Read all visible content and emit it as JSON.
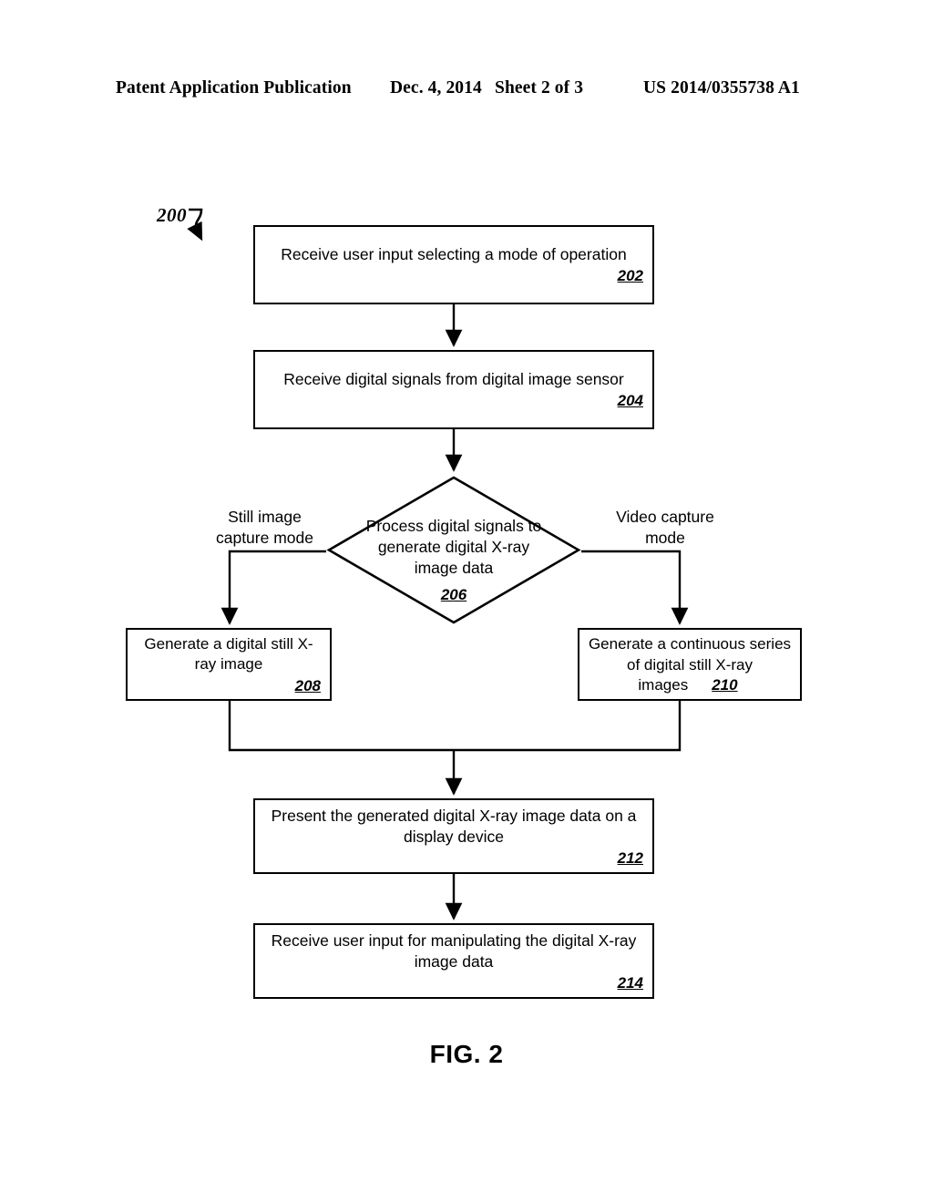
{
  "header": {
    "publication": "Patent Application Publication",
    "date": "Dec. 4, 2014",
    "sheet": "Sheet 2 of 3",
    "patent_number": "US 2014/0355738 A1"
  },
  "figure": {
    "caption": "FIG. 2",
    "reference_numeral": "200"
  },
  "flowchart": {
    "nodes": [
      {
        "id": "202",
        "type": "process",
        "text": "Receive user input selecting a mode of operation",
        "number": "202"
      },
      {
        "id": "204",
        "type": "process",
        "text": "Receive digital signals from digital image sensor",
        "number": "204"
      },
      {
        "id": "206",
        "type": "decision",
        "text": "Process digital signals to generate digital X-ray image data",
        "number": "206"
      },
      {
        "id": "208",
        "type": "process",
        "text": "Generate a digital still X-ray image",
        "number": "208"
      },
      {
        "id": "210",
        "type": "process",
        "text": "Generate a continuous series of digital still X-ray images",
        "number": "210"
      },
      {
        "id": "212",
        "type": "process",
        "text": "Present the generated digital X-ray image data on a display device",
        "number": "212"
      },
      {
        "id": "214",
        "type": "process",
        "text": "Receive user input for manipulating the digital X-ray image data",
        "number": "214"
      }
    ],
    "edge_labels": {
      "left_branch": "Still image\ncapture mode",
      "right_branch": "Video capture\nmode"
    }
  },
  "colors": {
    "stroke": "#000000",
    "background": "#ffffff"
  }
}
